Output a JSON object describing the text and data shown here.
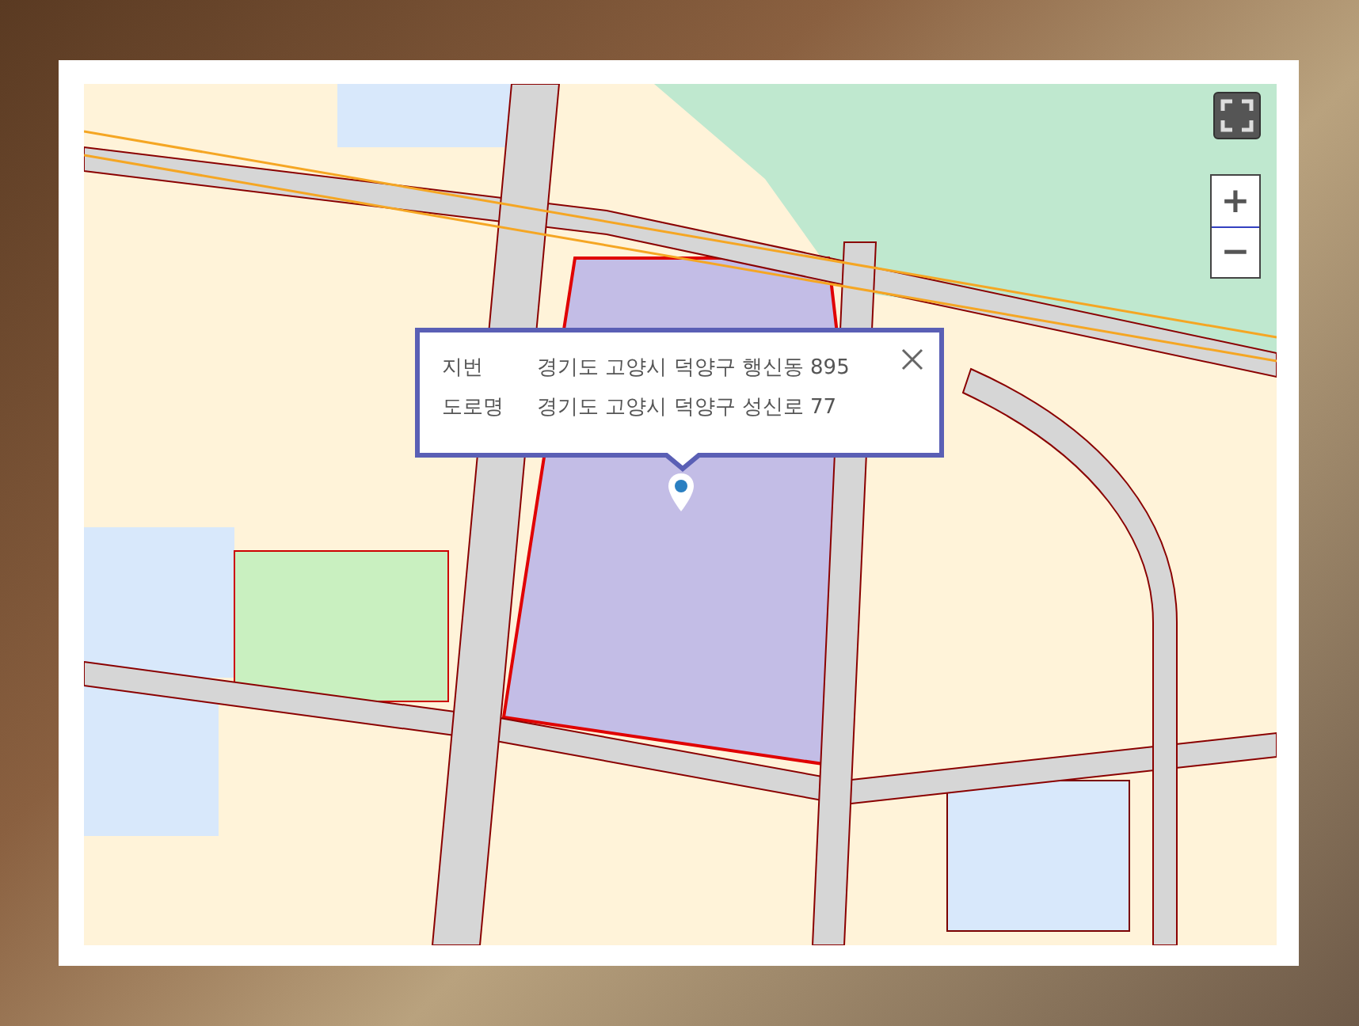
{
  "popup": {
    "rows": [
      {
        "label": "지번",
        "value": "경기도 고양시 덕양구 행신동 895"
      },
      {
        "label": "도로명",
        "value": "경기도 고양시 덕양구 성신로 77"
      }
    ]
  },
  "zoom_controls": {
    "zoom_in": "+",
    "zoom_out": "−"
  }
}
